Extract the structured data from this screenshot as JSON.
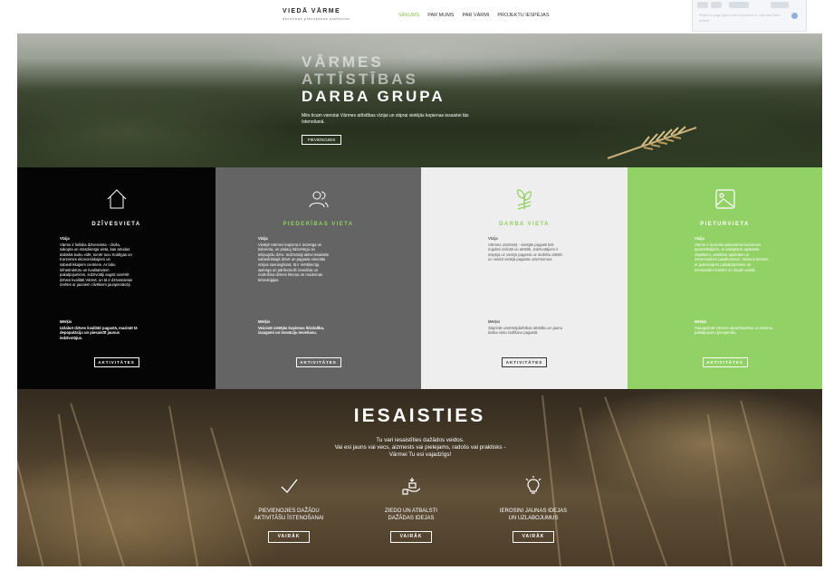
{
  "header": {
    "brand_name": "VIEDĀ VĀRME",
    "brand_sub": "attīstības plānošanas platforma",
    "nav": [
      "SĀKUMS",
      "PAR MUMS",
      "PAR VĀRMI",
      "PROJEKTU IESPĒJAS"
    ],
    "active_nav": "SĀKUMS",
    "ghost_text": "Select a page type from the menu or click the New button"
  },
  "hero": {
    "title_lines": [
      "VĀRMES",
      "ATTĪSTĪBAS",
      "DARBA GRUPA"
    ],
    "description": "Mēs ticam vienotai Vārmes attīstības vīzijai un stiprai vietējās kopienas iesaistei tās īstenošanā.",
    "button": "PIEVIENOJIES"
  },
  "columns": [
    {
      "heading": "DZĪVESVIETA",
      "icon": "house-icon",
      "vision_label": "Vīzija",
      "vision_text": "Vārme ir lieliska dzīvesvieta - droša, sakopta un mūsdienīga vieta, kas atrodas dabiskā lauku vidē, tomēr tuvu Kuldīgas un Kurzemes ekonomiskajiem un sabiedriskajiem centriem. Ar labu infrastruktūru un kvalitatīviem pakalpojumiem, iedzīvotāji augsti novērtē dzīves kvalitāti Vārmē, un tā ir dzīvesvietas izvēles ar jauniem cilvēkiem jaunpienācēji.",
      "goal_label": "Mērķis",
      "goal_text": "Uzlabot dzīves kvalitāti pagastā, mazināt tā depopulāciju un piesaistīt jaunus iedzīvotājus.",
      "button": "AKTIVITĀTES"
    },
    {
      "heading": "PIEDERĪBAS VIETA",
      "icon": "people-icon",
      "vision_label": "Vīzija",
      "vision_text": "Vietējā Vārmes kopiena ir iecietīga un tolerenta, un pieļauj līdzvērtīgu un iekļaujošu dzīvi. Iedzīvotāji aktīvi iesaistās sabiedriskajā dzīvē un pagasta vienotās vīzijas sasniegšanā, tā ir mērķtiecīgi, spēcīga un pārliecinoši izveidota un nodrošina dzīves līmeņa un modernas tehnoloģijas.",
      "goal_label": "Mērķis",
      "goal_text": "Veicināt vietējās kopienas līdzdalību, izaugsmi un inovāciju ieviešanu.",
      "button": "AKTIVITĀTES"
    },
    {
      "heading": "DARBA VIETA",
      "icon": "plant-icon",
      "vision_label": "Vīzija",
      "vision_text": "Vārmes uzņēmēji - vietējās pagasti tiek regulāri izzināti un attīstīti, iedzīvotājiem ir iespēja uz vietējo pagastu uz darbību attīstīt un veidot vietējā pagasta uzņēmumus.",
      "goal_label": "Mērķis",
      "goal_text": "Stiprināt uzņēmējdarbības attīstību un jaunu darba vietu radīšanu pagastā.",
      "button": "AKTIVITĀTES"
    },
    {
      "heading": "PIETURVIETA",
      "icon": "image-icon",
      "vision_label": "Vīzija",
      "vision_text": "Vārme ir iecienīta pieturvieta Kurzemes apmeklētājiem, ar sakoptiem apskates objektiem, atraktīvu apskates un interesantiem pasākumiem. Vārmes tūrisms ar galvenajiem pakalpojumiem un intresantām trasēm un daudz vairāk.",
      "goal_label": "Mērķis",
      "goal_text": "Paaugstināt Vārmes atpazīstamību un tūrisma pakalpojumu pieejamību.",
      "button": "AKTIVITĀTES"
    }
  ],
  "engage": {
    "title": "IESAISTIES",
    "desc_lines": [
      "Tu vari iesaistīties dažādos veidos.",
      "Vai esi jauns vai vecs, aizmests vai pielejams, radošs vai praktisks -",
      "Vārmei Tu esi vajadzīgs!"
    ],
    "items": [
      {
        "icon": "checkmark-icon",
        "label_lines": [
          "PIEVIENOJIES DAŽĀDU",
          "AKTIVITĀŠU ĪSTENOŠANAI"
        ],
        "button": "VAIRĀK"
      },
      {
        "icon": "donate-hand-icon",
        "label_lines": [
          "ZIEDO UN ATBALSTI",
          "DAŽĀDAS IDEJAS"
        ],
        "button": "VAIRĀK"
      },
      {
        "icon": "lightbulb-icon",
        "label_lines": [
          "IEROSINI JAUNAS IDEJAS",
          "UN UZLABOJUMUS"
        ],
        "button": "VAIRĀK"
      }
    ]
  },
  "colors": {
    "accent_green": "#86c34c",
    "column_green": "#92d165",
    "column_dark": "#050505",
    "column_grey": "#646464",
    "column_light": "#eeeeee"
  }
}
